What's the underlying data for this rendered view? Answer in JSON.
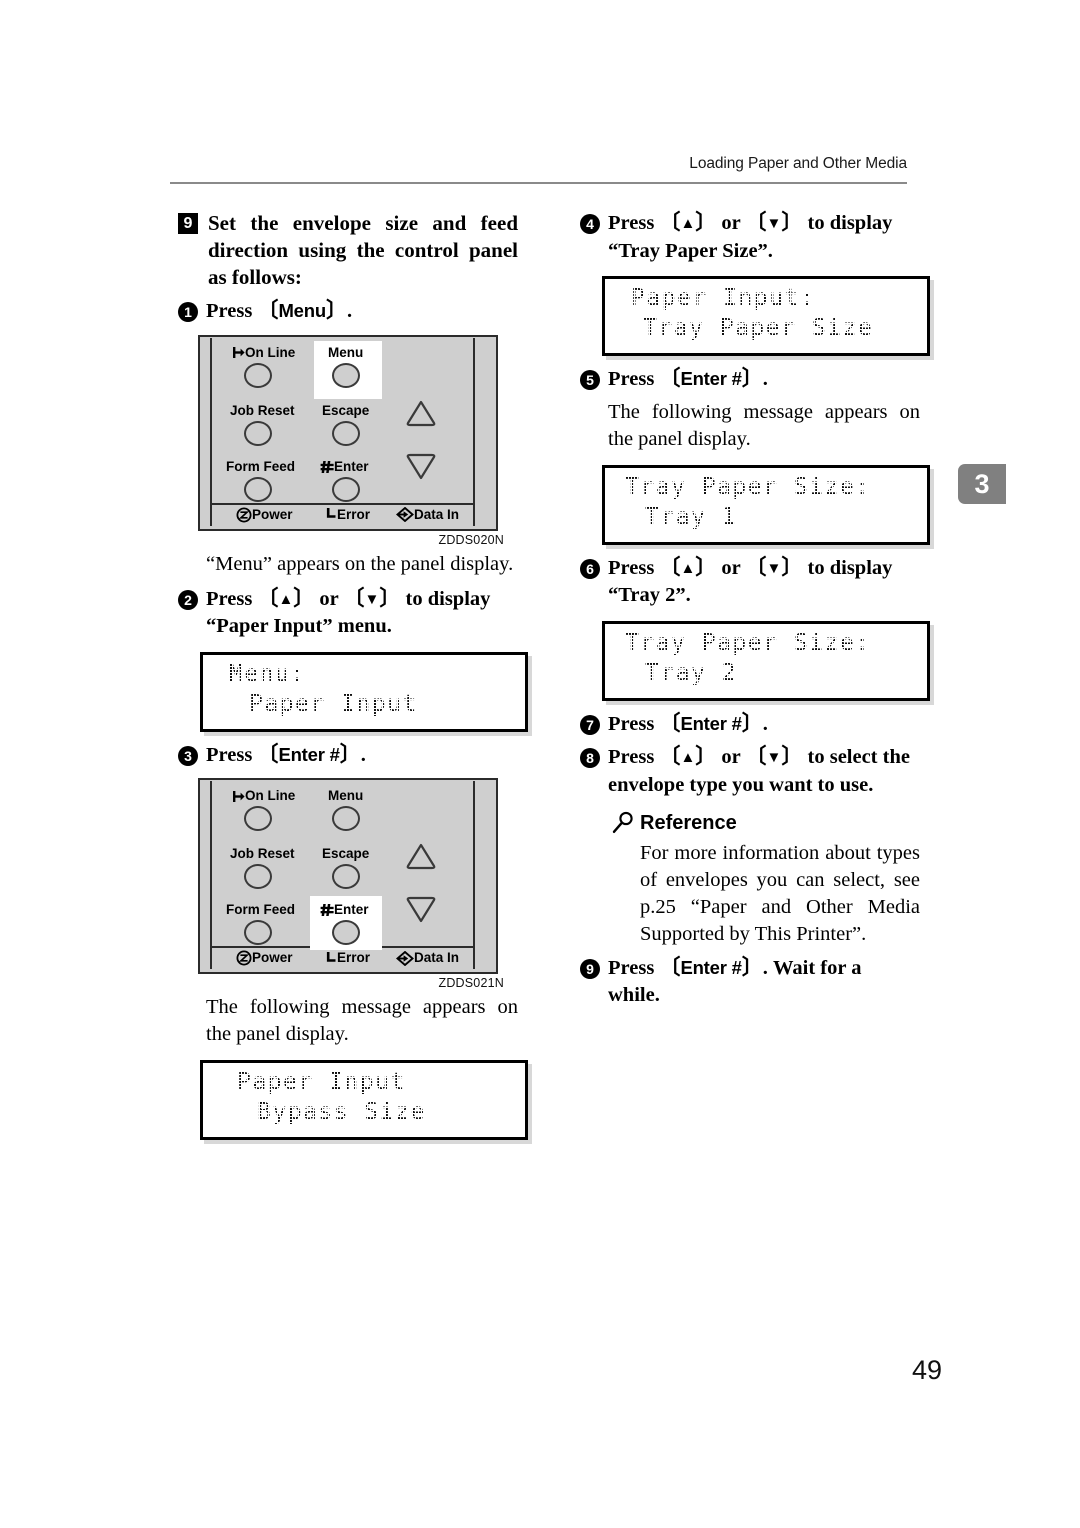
{
  "header": {
    "title": "Loading Paper and Other Media"
  },
  "chapter_tab": {
    "number": "3",
    "color": "#808080"
  },
  "page_number": "49",
  "left_column": {
    "step9": {
      "marker": "9",
      "text": "Set the envelope size and feed direction using the control panel as follows:"
    },
    "step1": {
      "marker": "1",
      "pre": "Press",
      "key": "Menu",
      "post": "."
    },
    "panel1": {
      "code": "ZDDS020N",
      "highlight": "Menu",
      "keys": [
        {
          "label": "On Line",
          "icon": "on-line-icon"
        },
        {
          "label": "Menu",
          "icon": null
        },
        {
          "label": "Job Reset",
          "icon": null
        },
        {
          "label": "Escape",
          "icon": null
        },
        {
          "label": "Form Feed",
          "icon": null
        },
        {
          "label": "Enter",
          "icon": "hash-icon"
        }
      ],
      "indicators": [
        {
          "label": "Power",
          "icon": "power-icon"
        },
        {
          "label": "Error",
          "icon": "error-icon"
        },
        {
          "label": "Data In",
          "icon": "data-in-icon"
        }
      ],
      "arrows": [
        "up-triangle-icon",
        "down-triangle-icon"
      ]
    },
    "note1": "“Menu” appears on the panel display.",
    "step2": {
      "marker": "2",
      "line1_pre": "Press",
      "key_up": "▲",
      "or": "or",
      "key_down": "▼",
      "line1_post": "to  display",
      "line2": "“Paper Input” menu."
    },
    "lcd1": {
      "line1": "Menu:",
      "line2": "Paper Input"
    },
    "step3": {
      "marker": "3",
      "pre": "Press",
      "key": "Enter #",
      "post": "."
    },
    "panel2": {
      "code": "ZDDS021N",
      "highlight": "Enter",
      "keys": [
        {
          "label": "On Line",
          "icon": "on-line-icon"
        },
        {
          "label": "Menu",
          "icon": null
        },
        {
          "label": "Job Reset",
          "icon": null
        },
        {
          "label": "Escape",
          "icon": null
        },
        {
          "label": "Form Feed",
          "icon": null
        },
        {
          "label": "Enter",
          "icon": "hash-icon"
        }
      ],
      "indicators": [
        {
          "label": "Power",
          "icon": "power-icon"
        },
        {
          "label": "Error",
          "icon": "error-icon"
        },
        {
          "label": "Data In",
          "icon": "data-in-icon"
        }
      ]
    },
    "note2": "The following message appears on the panel display.",
    "lcd2": {
      "line1": "Paper Input",
      "line2": "Bypass Size"
    }
  },
  "right_column": {
    "step4": {
      "marker": "4",
      "line1_pre": "Press",
      "key_up": "▲",
      "or": "or",
      "key_down": "▼",
      "line1_post": "to  display",
      "line2": "“Tray Paper Size”."
    },
    "lcd3": {
      "line1": "Paper Input:",
      "line2": "Tray Paper Size"
    },
    "step5": {
      "marker": "5",
      "pre": "Press",
      "key": "Enter #",
      "post": "."
    },
    "note5": "The following message appears on the panel display.",
    "lcd4": {
      "line1": "Tray Paper Size:",
      "line2": "Tray 1"
    },
    "step6": {
      "marker": "6",
      "line1_pre": "Press",
      "key_up": "▲",
      "or": "or",
      "key_down": "▼",
      "line1_post": "to  display",
      "line2": "“Tray 2”."
    },
    "lcd5": {
      "line1": "Tray Paper Size:",
      "line2": "Tray 2"
    },
    "step7": {
      "marker": "7",
      "pre": "Press",
      "key": "Enter #",
      "post": "."
    },
    "step8": {
      "marker": "8",
      "line1_pre": "Press",
      "key_up": "▲",
      "or": "or",
      "key_down": "▼",
      "line1_post": "to select the",
      "line2": "envelope type you want to use."
    },
    "reference": {
      "icon": "magnifier-icon",
      "heading": "Reference",
      "body": "For more information about types of envelopes you can select, see p.25 “Paper and Other Media Supported by This Printer”."
    },
    "step9": {
      "marker": "9",
      "pre": "Press",
      "key": "Enter #",
      "post": ". Wait  for  a",
      "line2": "while."
    }
  }
}
